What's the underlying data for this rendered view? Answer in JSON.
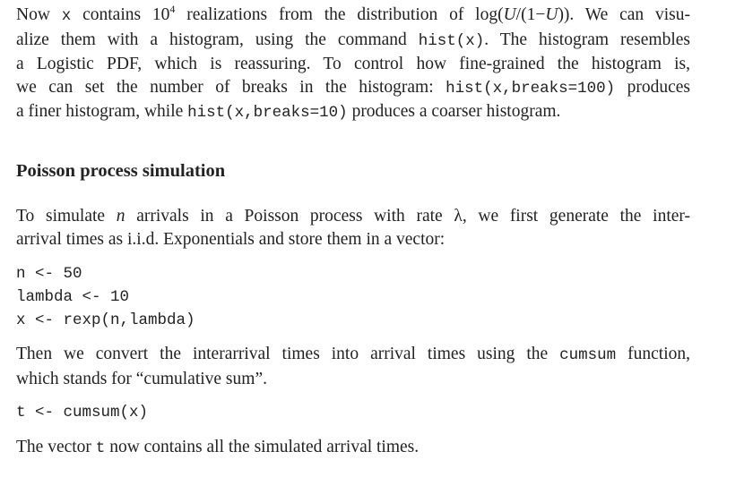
{
  "intro": {
    "l1_a": "Now ",
    "l1_x": "x",
    "l1_b": " contains 10",
    "l1_exp": "4",
    "l1_c": " realizations from the distribution of log(",
    "l1_u1": "U",
    "l1_d": "/(1−",
    "l1_u2": "U",
    "l1_e": ")). We can visu-",
    "l2_a": "alize them with a histogram, using the command ",
    "l2_code": "hist(x)",
    "l2_b": ". The histogram resembles",
    "l3": "a Logistic PDF, which is reassuring. To control how fine-grained the histogram is,",
    "l4_a": "we can set the number of breaks in the histogram: ",
    "l4_code": "hist(x,breaks=100)",
    "l4_b": " produces",
    "l5_a": "a finer histogram, while ",
    "l5_code": "hist(x,breaks=10)",
    "l5_b": " produces a coarser histogram."
  },
  "section": {
    "title": "Poisson process simulation"
  },
  "p2": {
    "l1_a": "To simulate ",
    "l1_n": "n",
    "l1_b": " arrivals in a Poisson process with rate λ, we first generate the inter-",
    "l2": "arrival times as i.i.d. Exponentials and store them in a vector:"
  },
  "code1": {
    "line1": "n <- 50",
    "line2": "lambda <- 10",
    "line3": "x <- rexp(n,lambda)"
  },
  "p3": {
    "l1_a": "Then we convert the interarrival times into arrival times using the ",
    "l1_code": "cumsum",
    "l1_b": " function,",
    "l2": "which stands for “cumulative sum”."
  },
  "code2": {
    "line1": "t <- cumsum(x)"
  },
  "p4": {
    "a": "The vector ",
    "code": "t",
    "b": " now contains all the simulated arrival times."
  }
}
